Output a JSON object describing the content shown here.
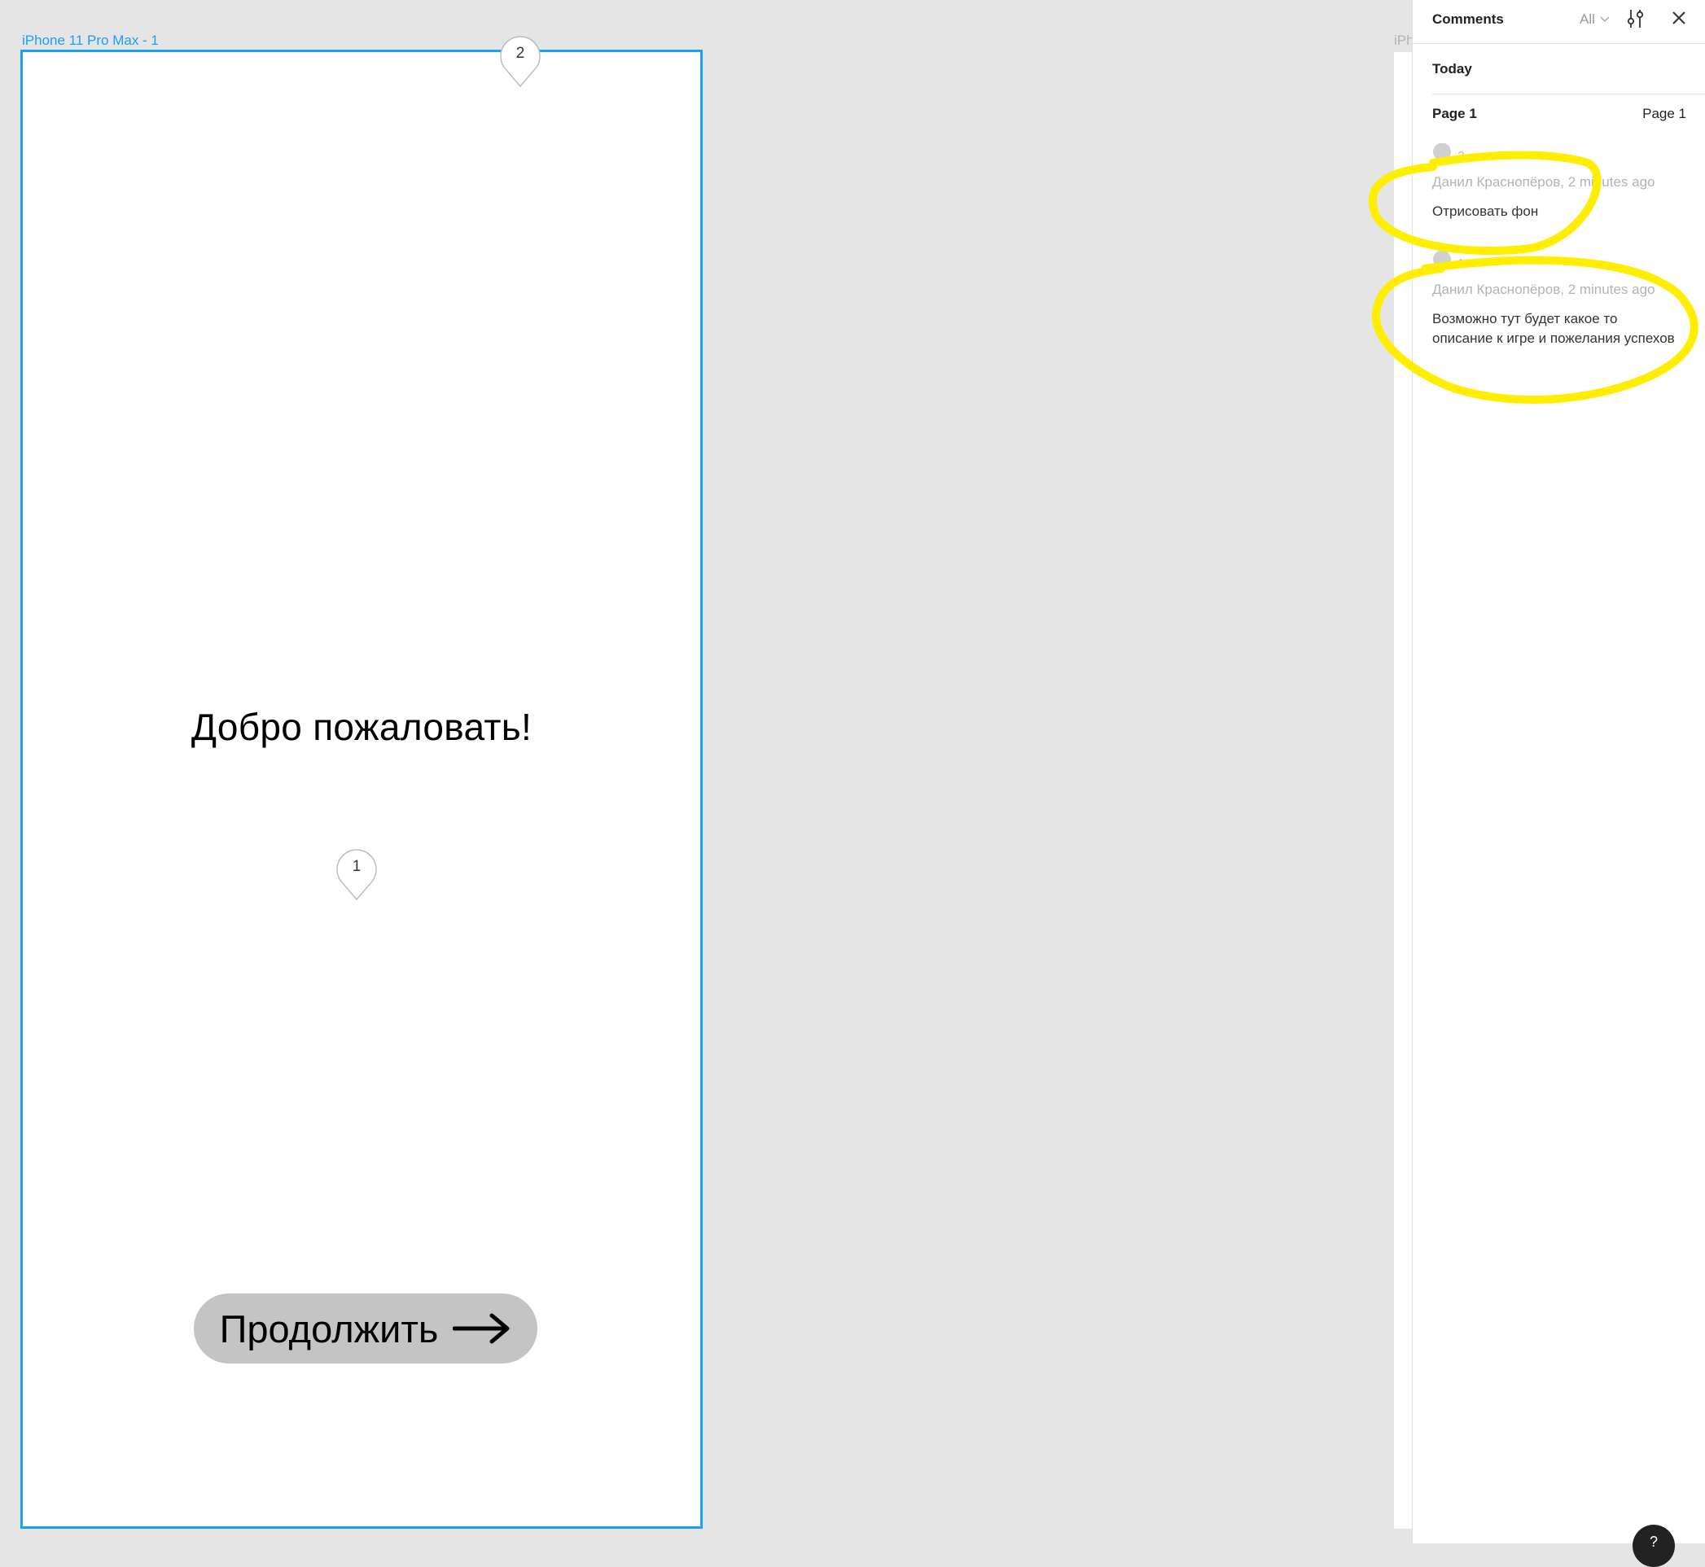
{
  "canvas": {
    "frame_label": "iPhone 11 Pro Max - 1",
    "next_frame_label": "iPhone",
    "screen": {
      "welcome_text": "Добро пожаловать!",
      "continue_label": "Продолжить"
    },
    "pins": [
      {
        "number": "2"
      },
      {
        "number": "1"
      }
    ]
  },
  "comments_panel": {
    "title": "Comments",
    "filter_label": "All",
    "section_label": "Today",
    "page_label": "Page 1",
    "page_label_right": "Page 1",
    "comments": [
      {
        "number": "2",
        "meta": "Данил Краснопёров, 2 minutes ago",
        "text": "Отрисовать фон"
      },
      {
        "number": "1",
        "meta": "Данил Краснопёров, 2 minutes ago",
        "text": "Возможно тут будет какое то описание к игре и пожелания успехов"
      }
    ]
  },
  "help_label": "?",
  "colors": {
    "selection": "#18a0fb",
    "button_bg": "#c4c4c4",
    "highlight": "#ffee00"
  }
}
